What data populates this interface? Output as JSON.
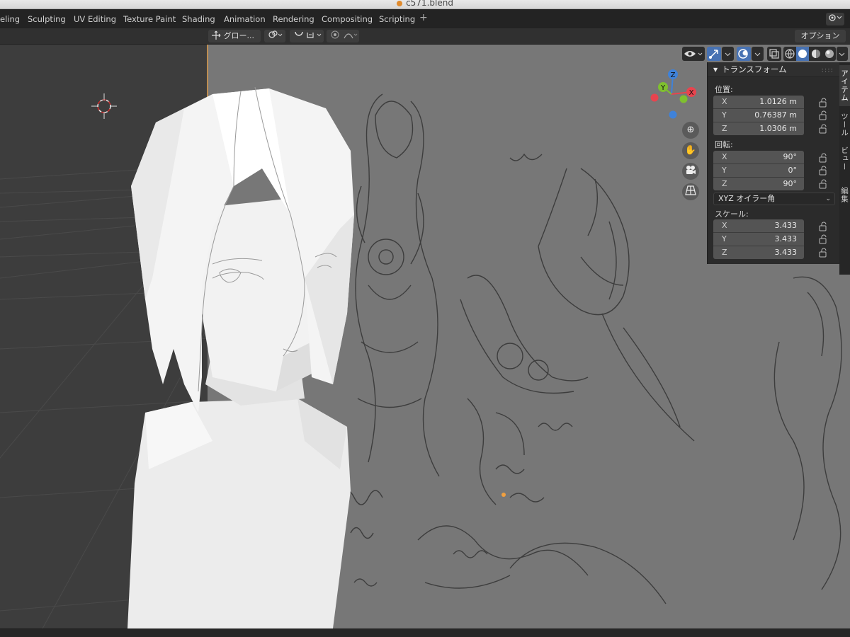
{
  "window": {
    "title": "c571.blend"
  },
  "workspace_tabs": [
    "eling",
    "Sculpting",
    "UV Editing",
    "Texture Paint",
    "Shading",
    "Animation",
    "Rendering",
    "Compositing",
    "Scripting"
  ],
  "add_tab_label": "+",
  "header": {
    "transform_orientation": "グロー...",
    "options_label": "オプション"
  },
  "sidebar_tabs": [
    "アイテム",
    "ツール",
    "ビュー",
    "編集"
  ],
  "transform_panel": {
    "title": "トランスフォーム",
    "location_label": "位置:",
    "location": [
      {
        "axis": "X",
        "value": "1.0126 m"
      },
      {
        "axis": "Y",
        "value": "0.76387 m"
      },
      {
        "axis": "Z",
        "value": "1.0306 m"
      }
    ],
    "rotation_label": "回転:",
    "rotation": [
      {
        "axis": "X",
        "value": "90°"
      },
      {
        "axis": "Y",
        "value": "0°"
      },
      {
        "axis": "Z",
        "value": "90°"
      }
    ],
    "rotation_mode": "XYZ オイラー角",
    "scale_label": "スケール:",
    "scale": [
      {
        "axis": "X",
        "value": "3.433"
      },
      {
        "axis": "Y",
        "value": "3.433"
      },
      {
        "axis": "Z",
        "value": "3.433"
      }
    ]
  },
  "gizmo": {
    "z": "Z",
    "y": "Y",
    "x": "X"
  },
  "colors": {
    "accent": "#4772b3",
    "viewport_bg": "#3d3d3d",
    "axis_x": "#e8444e",
    "axis_y": "#7fc02f",
    "axis_z": "#3f82d9",
    "origin_dot": "#f0a040"
  },
  "icons": {
    "visibility": "eye-icon",
    "gizmo_toggle": "gizmo-icon",
    "overlay": "overlay-icon",
    "xray": "xray-icon",
    "shading_wire": "wireframe-icon",
    "shading_solid": "solid-icon",
    "shading_material": "material-icon",
    "shading_render": "render-icon",
    "zoom": "zoom-icon",
    "pan": "hand-icon",
    "camera": "camera-icon",
    "perspective": "grid-icon",
    "lock": "lock-icon"
  }
}
